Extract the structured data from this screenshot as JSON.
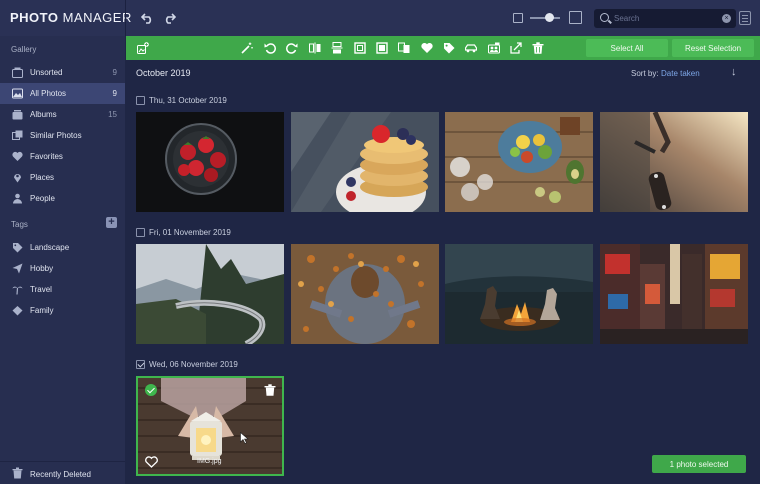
{
  "app": {
    "logo_bold": "PHOTO",
    "logo_thin": " MANAGER"
  },
  "search": {
    "placeholder": "Search"
  },
  "sidebar": {
    "gallery_heading": "Gallery",
    "tags_heading": "Tags",
    "items": [
      {
        "label": "Unsorted",
        "count": "9"
      },
      {
        "label": "All Photos",
        "count": "9"
      },
      {
        "label": "Albums",
        "count": "15"
      },
      {
        "label": "Similar Photos",
        "count": ""
      },
      {
        "label": "Favorites",
        "count": ""
      },
      {
        "label": "Places",
        "count": ""
      },
      {
        "label": "People",
        "count": ""
      }
    ],
    "tags": [
      {
        "label": "Landscape"
      },
      {
        "label": "Hobby"
      },
      {
        "label": "Travel"
      },
      {
        "label": "Family"
      }
    ],
    "recently_deleted": "Recently Deleted"
  },
  "toolbar": {
    "select_all": "Select All",
    "reset_selection": "Reset Selection"
  },
  "main": {
    "month": "October 2019",
    "sort_label": "Sort by:",
    "sort_value": "Date taken",
    "groups": [
      {
        "date": "Thu, 31 October 2019",
        "checked": false
      },
      {
        "date": "Fri, 01 November 2019",
        "checked": false
      },
      {
        "date": "Wed, 06 November 2019",
        "checked": true
      }
    ],
    "selected_filename": "IMG.jpg",
    "status": "1 photo selected"
  },
  "colors": {
    "accent_green": "#3fa84a",
    "sidebar_bg": "#272e50",
    "main_bg": "#1f2645",
    "active_item": "#3c4674"
  },
  "icons": [
    "undo-icon",
    "redo-icon",
    "zoom-out-icon",
    "zoom-in-icon",
    "search-icon",
    "filter-icon",
    "add-to-album-icon",
    "magic-wand-icon",
    "rotate-left-icon",
    "rotate-right-icon",
    "flip-horizontal-icon",
    "flip-vertical-icon",
    "crop-icon",
    "resize-icon",
    "compare-icon",
    "heart-icon",
    "tag-icon",
    "car-icon",
    "people-icon",
    "share-icon",
    "trash-icon"
  ]
}
